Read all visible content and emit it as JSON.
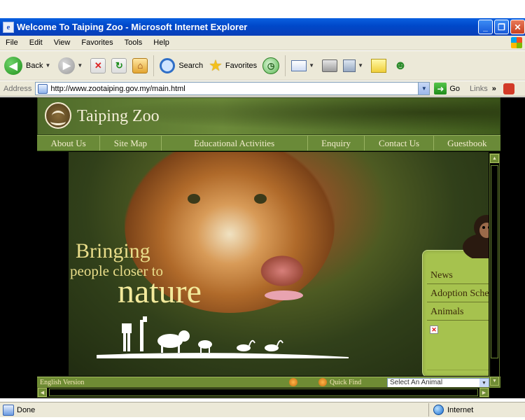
{
  "window": {
    "title": "Welcome To Taiping Zoo - Microsoft Internet Explorer",
    "min_glyph": "_",
    "max_glyph": "❐",
    "close_glyph": "✕"
  },
  "menubar": {
    "items": [
      "File",
      "Edit",
      "View",
      "Favorites",
      "Tools",
      "Help"
    ]
  },
  "toolbar": {
    "back_label": "Back",
    "search_label": "Search",
    "favorites_label": "Favorites",
    "icons": [
      "back-arrow-icon",
      "forward-arrow-icon",
      "stop-icon",
      "refresh-icon",
      "home-icon",
      "search-icon",
      "favorites-star-icon",
      "history-icon",
      "mail-icon",
      "print-icon",
      "edit-icon",
      "discuss-icon",
      "messenger-icon"
    ]
  },
  "address": {
    "label": "Address",
    "url": "http://www.zootaiping.gov.my/main.html",
    "go_label": "Go",
    "links_label": "Links"
  },
  "site": {
    "name": "Taiping Zoo",
    "nav": [
      "About Us",
      "Site Map",
      "Educational Activities",
      "Enquiry",
      "Contact Us",
      "Guestbook"
    ],
    "slogan": {
      "line1": "Bringing",
      "line2": "people closer to",
      "line3": "nature"
    },
    "side_links": [
      "News",
      "Adoption Scheme",
      "Animals"
    ],
    "bottom_left_text": "English Version",
    "bottom_right_text": "Quick Find",
    "animal_select_value": "Select An Animal"
  },
  "status": {
    "text": "Done",
    "zone": "Internet"
  },
  "colors": {
    "site_green": "#6a8a38",
    "panel_green": "#a6c24e",
    "title_blue": "#0a5fe0"
  }
}
